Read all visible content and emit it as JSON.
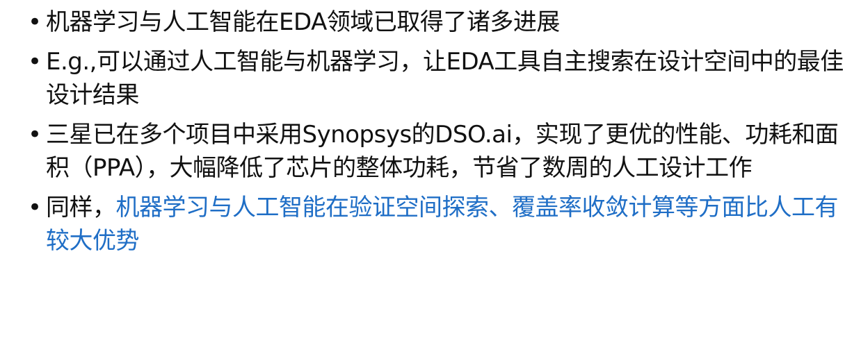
{
  "bullets": [
    {
      "text": "机器学习与人工智能在EDA领域已取得了诸多进展"
    },
    {
      "text": "E.g.,可以通过人工智能与机器学习，让EDA工具自主搜索在设计空间中的最佳设计结果"
    },
    {
      "text": "三星已在多个项目中采用Synopsys的DSO.ai，实现了更优的性能、功耗和面积（PPA），大幅降低了芯片的整体功耗，节省了数周的人工设计工作"
    },
    {
      "prefix": "同样，",
      "highlight": "机器学习与人工智能在验证空间探索、覆盖率收敛计算等方面比人工有较大优势"
    }
  ],
  "bullet_glyph": "•",
  "colors": {
    "text": "#111111",
    "highlight": "#1f6ec6",
    "background": "#ffffff"
  }
}
